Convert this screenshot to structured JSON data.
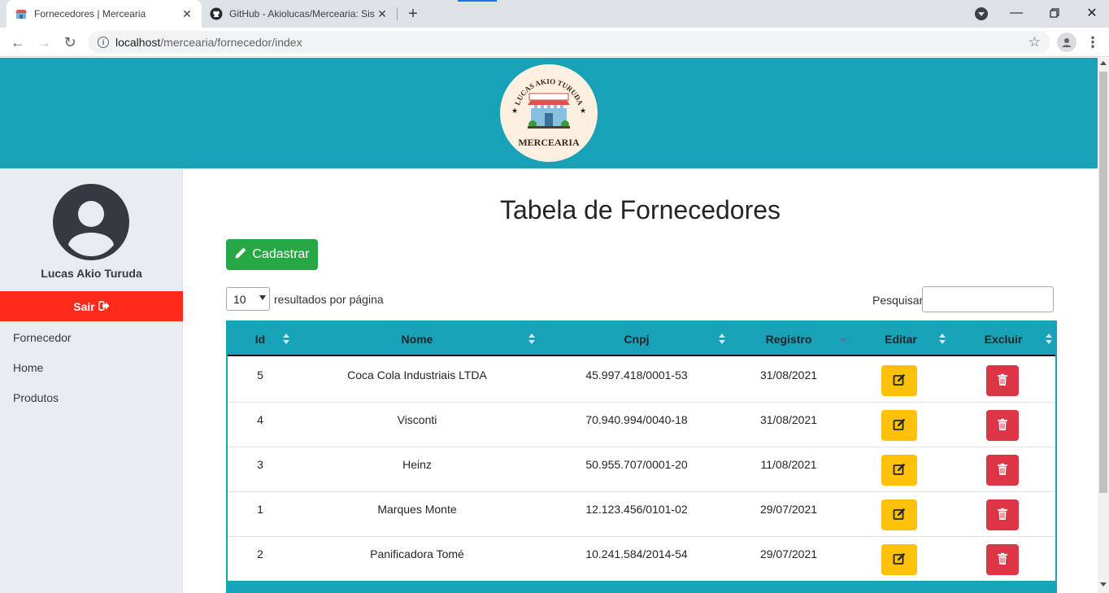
{
  "browser": {
    "tabs": [
      {
        "title": "Fornecedores | Mercearia",
        "active": true
      },
      {
        "title": "GitHub - Akiolucas/Mercearia: Sis",
        "active": false
      }
    ],
    "url_host": "localhost",
    "url_path": "/mercearia/fornecedor/index"
  },
  "logo": {
    "top_text": "LUCAS AKIO TURUDA",
    "bottom_text": "MERCEARIA"
  },
  "sidebar": {
    "user_name": "Lucas Akio Turuda",
    "logout_label": "Sair",
    "items": [
      {
        "label": "Fornecedor"
      },
      {
        "label": "Home"
      },
      {
        "label": "Produtos"
      }
    ]
  },
  "main": {
    "title": "Tabela de Fornecedores",
    "create_label": "Cadastrar",
    "page_length": "10",
    "page_length_label": "resultados por página",
    "search_label": "Pesquisar",
    "search_value": ""
  },
  "table": {
    "headers": [
      "Id",
      "Nome",
      "Cnpj",
      "Registro",
      "Editar",
      "Excluir"
    ],
    "rows": [
      {
        "id": "5",
        "nome": "Coca Cola Industriais LTDA",
        "cnpj": "45.997.418/0001-53",
        "registro": "31/08/2021"
      },
      {
        "id": "4",
        "nome": "Visconti",
        "cnpj": "70.940.994/0040-18",
        "registro": "31/08/2021"
      },
      {
        "id": "3",
        "nome": "Heinz",
        "cnpj": "50.955.707/0001-20",
        "registro": "11/08/2021"
      },
      {
        "id": "1",
        "nome": "Marques Monte",
        "cnpj": "12.123.456/0101-02",
        "registro": "29/07/2021"
      },
      {
        "id": "2",
        "nome": "Panificadora Tomé",
        "cnpj": "10.241.584/2014-54",
        "registro": "29/07/2021"
      }
    ]
  },
  "colors": {
    "header": "#17a2b8",
    "success": "#28a745",
    "warning": "#ffc107",
    "danger": "#dc3545",
    "logout": "#ff2a1a"
  }
}
